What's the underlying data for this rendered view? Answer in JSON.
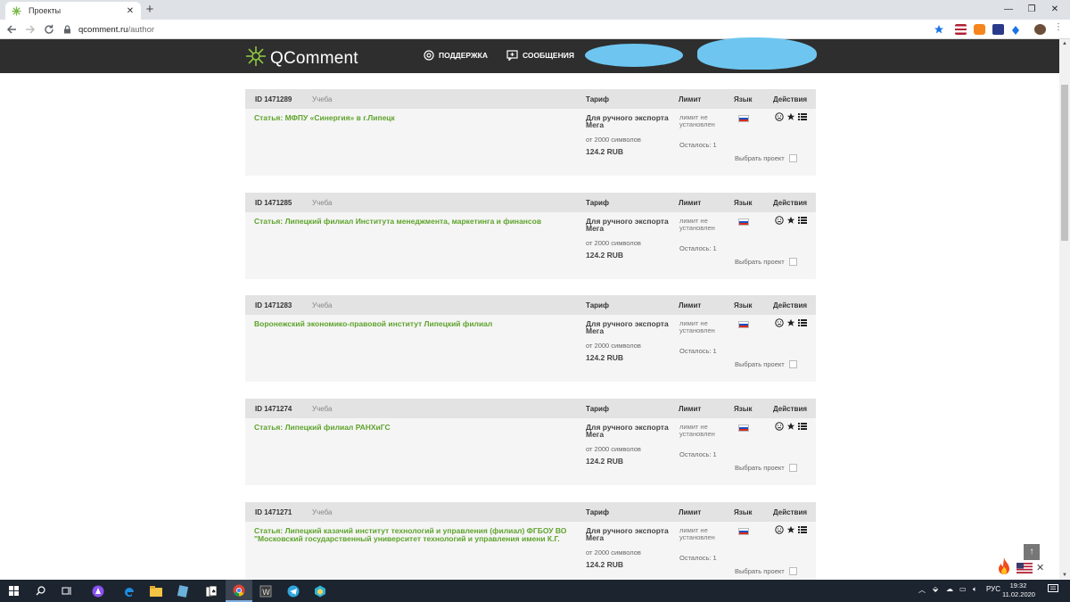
{
  "browser": {
    "tab_title": "Проекты",
    "tab_close": "✕",
    "new_tab": "+",
    "url_host": "qcomment.ru",
    "url_path": "/author",
    "win_minimize": "—",
    "win_restore": "❐",
    "win_close": "✕"
  },
  "site": {
    "logo_text": "QComment",
    "nav_support": "ПОДДЕРЖКА",
    "nav_messages": "СООБЩЕНИЯ"
  },
  "columns": {
    "tariff": "Тариф",
    "limit": "Лимит",
    "lang": "Язык",
    "actions": "Действия"
  },
  "projects": [
    {
      "id": "ID 1471289",
      "category": "Учеба",
      "title": "Статья: МФПУ «Синергия» в г.Липецк",
      "tariff": "Для ручного экспорта Мега",
      "chars": "от 2000 символов",
      "price": "124.2 RUB",
      "limit": "лимит не установлен",
      "remaining": "Осталось: 1",
      "select_label": "Выбрать проект"
    },
    {
      "id": "ID 1471285",
      "category": "Учеба",
      "title": "Статья: Липецкий филиал Института менеджмента, маркетинга и финансов",
      "tariff": "Для ручного экспорта Мега",
      "chars": "от 2000 символов",
      "price": "124.2 RUB",
      "limit": "лимит не установлен",
      "remaining": "Осталось: 1",
      "select_label": "Выбрать проект"
    },
    {
      "id": "ID 1471283",
      "category": "Учеба",
      "title": "Воронежский экономико-правовой институт Липецкий филиал",
      "tariff": "Для ручного экспорта Мега",
      "chars": "от 2000 символов",
      "price": "124.2 RUB",
      "limit": "лимит не установлен",
      "remaining": "Осталось: 1",
      "select_label": "Выбрать проект"
    },
    {
      "id": "ID 1471274",
      "category": "Учеба",
      "title": "Статья: Липецкий филиал РАНХиГС",
      "tariff": "Для ручного экспорта Мега",
      "chars": "от 2000 символов",
      "price": "124.2 RUB",
      "limit": "лимит не установлен",
      "remaining": "Осталось: 1",
      "select_label": "Выбрать проект"
    },
    {
      "id": "ID 1471271",
      "category": "Учеба",
      "title": "Статья: Липецкий казачий институт технологий и управления (филиал) ФГБОУ ВО \"Московский государственный университет технологий и управления имени К.Г.",
      "tariff": "Для ручного экспорта Мега",
      "chars": "от 2000 символов",
      "price": "124.2 RUB",
      "limit": "лимит не установлен",
      "remaining": "Осталось: 1",
      "select_label": "Выбрать проект"
    }
  ],
  "widgets": {
    "scroll_top": "↑",
    "close": "✕"
  },
  "taskbar": {
    "lang": "РУС",
    "time": "19:32",
    "date": "11.02.2020"
  }
}
